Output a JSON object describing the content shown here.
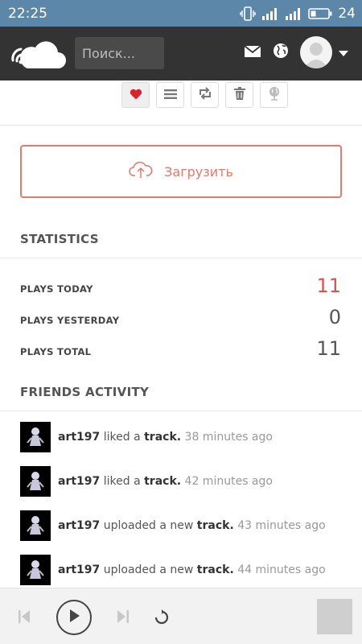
{
  "status_bar": {
    "time": "22:25",
    "battery": "24"
  },
  "header": {
    "search_placeholder": "Поиск..."
  },
  "track_actions": [
    "heart-icon",
    "list-icon",
    "repost-icon",
    "trash-icon",
    "globe-icon"
  ],
  "upload": {
    "label": "Загрузить"
  },
  "statistics": {
    "title": "STATISTICS",
    "rows": [
      {
        "label": "PLAYS TODAY",
        "value": "11"
      },
      {
        "label": "PLAYS YESTERDAY",
        "value": "0"
      },
      {
        "label": "PLAYS TOTAL",
        "value": "11"
      }
    ]
  },
  "friends_activity": {
    "title": "FRIENDS ACTIVITY",
    "items": [
      {
        "user": "art197",
        "action": "liked a",
        "object": "track.",
        "time": "38 minutes ago"
      },
      {
        "user": "art197",
        "action": "liked a",
        "object": "track.",
        "time": "42 minutes ago"
      },
      {
        "user": "art197",
        "action": "uploaded a new",
        "object": "track.",
        "time": "43 minutes ago"
      },
      {
        "user": "art197",
        "action": "uploaded a new",
        "object": "track.",
        "time": "44 minutes ago"
      }
    ]
  },
  "colors": {
    "accent": "#e3796f",
    "highlight": "#d9534f",
    "header": "#333333",
    "status_bar": "#5d87a8"
  }
}
